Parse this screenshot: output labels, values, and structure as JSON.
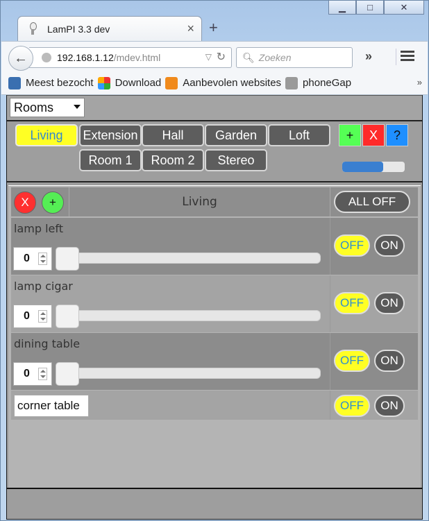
{
  "browser": {
    "tab_title": "LamPI 3.3 dev",
    "tab_close": "×",
    "new_tab": "+",
    "url_host": "192.168.1.12",
    "url_path": "/mdev.html",
    "search_placeholder": "Zoeken",
    "overflow": "»",
    "bookmarks": [
      {
        "label": "Meest bezocht",
        "color": "#3a6fb0"
      },
      {
        "label": "Download",
        "color": "#444444"
      },
      {
        "label": "Aanbevolen websites",
        "color": "#f08a1c"
      },
      {
        "label": "phoneGap",
        "color": "#999999"
      }
    ],
    "bookmarks_more": "»"
  },
  "topbar": {
    "select_value": "Rooms"
  },
  "rooms": {
    "buttons": [
      "Living",
      "Extension",
      "Hall",
      "Garden",
      "Loft",
      "Room 1",
      "Room 2",
      "Stereo"
    ],
    "active": "Living",
    "add_label": "+",
    "delete_label": "X",
    "help_label": "?",
    "progress": 0.65
  },
  "panel": {
    "delete_label": "X",
    "add_label": "+",
    "room_title": "Living",
    "all_off_label": "ALL OFF",
    "devices": [
      {
        "name": "lamp left",
        "value": "0",
        "off": "OFF",
        "on": "ON"
      },
      {
        "name": "lamp cigar",
        "value": "0",
        "off": "OFF",
        "on": "ON"
      },
      {
        "name": "dining table",
        "value": "0",
        "off": "OFF",
        "on": "ON"
      },
      {
        "name": "corner table",
        "off": "OFF",
        "on": "ON"
      }
    ]
  }
}
